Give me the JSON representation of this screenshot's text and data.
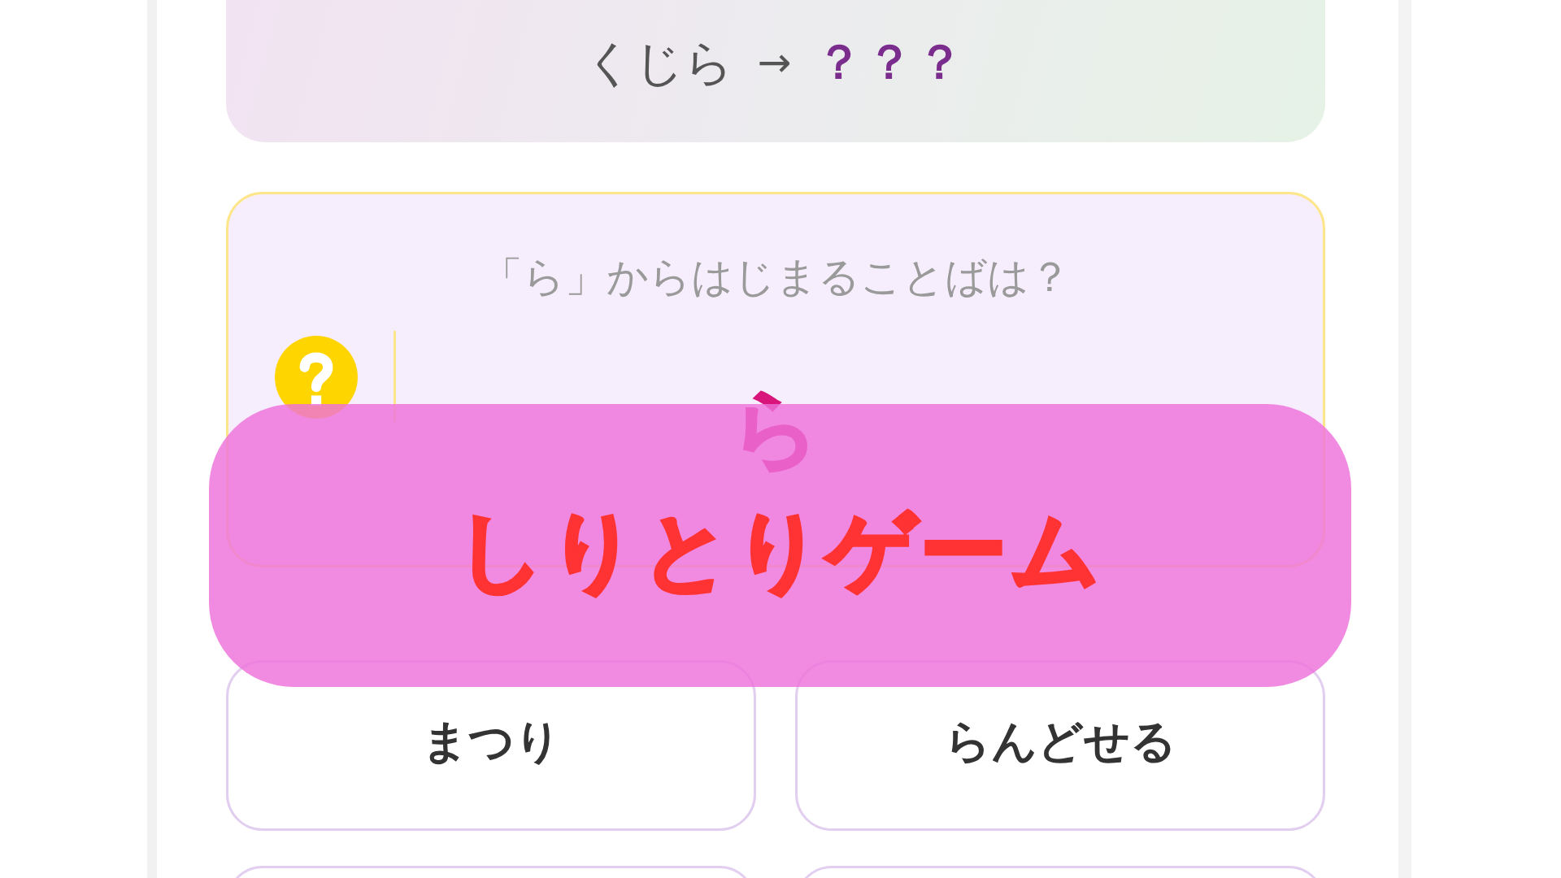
{
  "progress_banner": {
    "previous_word": "くじら",
    "arrow": "→",
    "next_word": "？？？"
  },
  "question_card": {
    "prompt": "「ら」からはじまることばは？",
    "start_letter": "ら"
  },
  "title_overlay": {
    "title": "しりとりゲーム"
  },
  "choices": [
    {
      "kind": "word",
      "label": "まつり"
    },
    {
      "kind": "word",
      "label": "らんどせる"
    },
    {
      "kind": "cut_off"
    },
    {
      "kind": "cut_off"
    }
  ]
}
